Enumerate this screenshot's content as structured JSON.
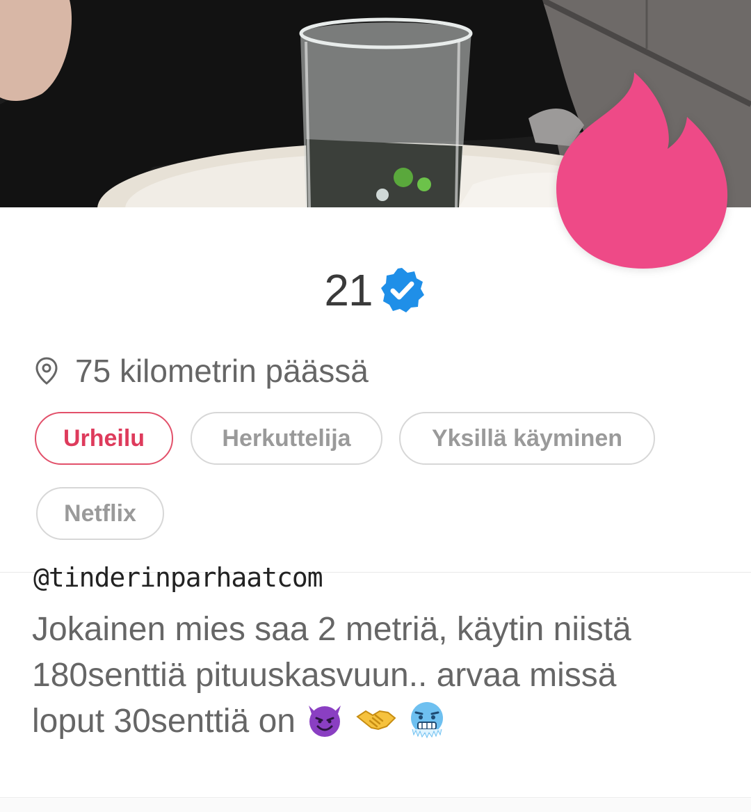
{
  "profile": {
    "age": "21",
    "distance": "75 kilometrin päässä",
    "interests": [
      {
        "label": "Urheilu",
        "active": true
      },
      {
        "label": "Herkuttelija",
        "active": false
      },
      {
        "label": "Yksillä käyminen",
        "active": false
      },
      {
        "label": "Netflix",
        "active": false
      }
    ],
    "watermark": "@tinderinparhaatcom",
    "bio_lines": [
      "Jokainen mies saa 2 metriä, käytin niistä",
      "180senttiä pituuskasvuun.. arvaa missä",
      "loput 30senttiä on"
    ]
  },
  "icons": {
    "flame": "tinder-flame-icon",
    "verified": "verified-badge-icon",
    "location": "location-pin-icon",
    "emojis": [
      "smiling-devil-emoji-icon",
      "handshake-emoji-icon",
      "cold-face-emoji-icon"
    ]
  },
  "colors": {
    "brand": "#ee4a87",
    "verified": "#1f8fe8",
    "active_chip": "#de3b5c"
  }
}
